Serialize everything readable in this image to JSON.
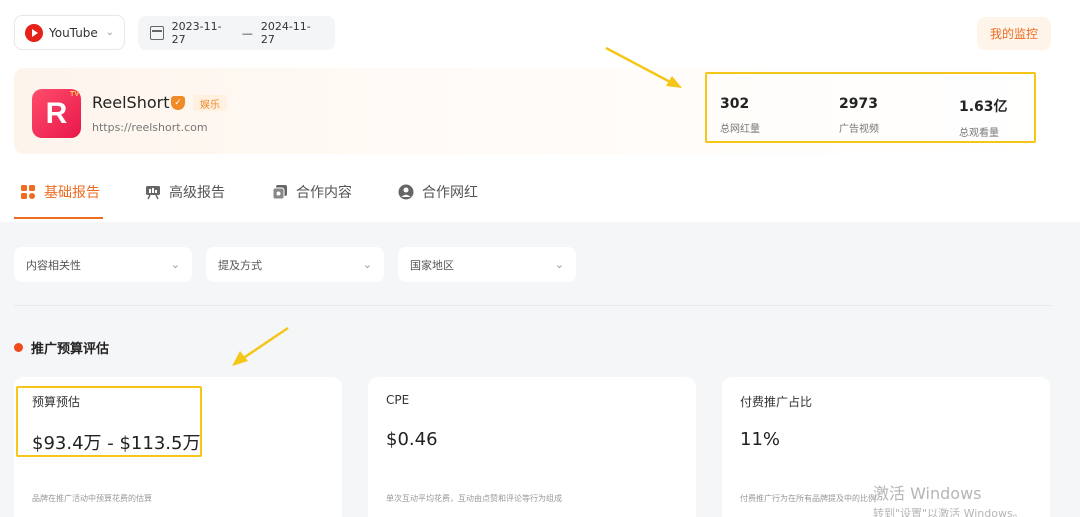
{
  "toolbar": {
    "platform_label": "YouTube",
    "date_start": "2023-11-27",
    "date_separator": "—",
    "date_end": "2024-11-27",
    "monitor_label": "我的监控"
  },
  "brand": {
    "name": "ReelShort",
    "tag": "娱乐",
    "url": "https://reelshort.com",
    "logo_letter": "R",
    "logo_badge": "TV"
  },
  "stats": [
    {
      "value": "302",
      "label": "总网红量"
    },
    {
      "value": "2973",
      "label": "广告视频"
    },
    {
      "value": "1.63亿",
      "label": "总观看量"
    }
  ],
  "tabs": [
    {
      "label": "基础报告",
      "icon": "grid-icon",
      "active": true
    },
    {
      "label": "高级报告",
      "icon": "presentation-icon",
      "active": false
    },
    {
      "label": "合作内容",
      "icon": "copy-icon",
      "active": false
    },
    {
      "label": "合作网红",
      "icon": "user-icon",
      "active": false
    }
  ],
  "filters": [
    {
      "label": "内容相关性"
    },
    {
      "label": "提及方式"
    },
    {
      "label": "国家地区"
    }
  ],
  "section": {
    "title": "推广预算评估"
  },
  "cards": [
    {
      "title": "预算预估",
      "value": "$93.4万 - $113.5万",
      "note": "品牌在推广活动中预算花费的估算"
    },
    {
      "title": "CPE",
      "value": "$0.46",
      "note": "单次互动平均花费，互动由点赞和评论等行为组成"
    },
    {
      "title": "付费推广占比",
      "value": "11%",
      "note": "付费推广行为在所有品牌提及中的比例"
    }
  ],
  "watermark": {
    "line1": "激活 Windows",
    "line2": "转到\"设置\"以激活 Windows。"
  },
  "colors": {
    "accent": "#ef6b20",
    "highlight": "#f5c518",
    "youtube_red": "#e62117"
  }
}
